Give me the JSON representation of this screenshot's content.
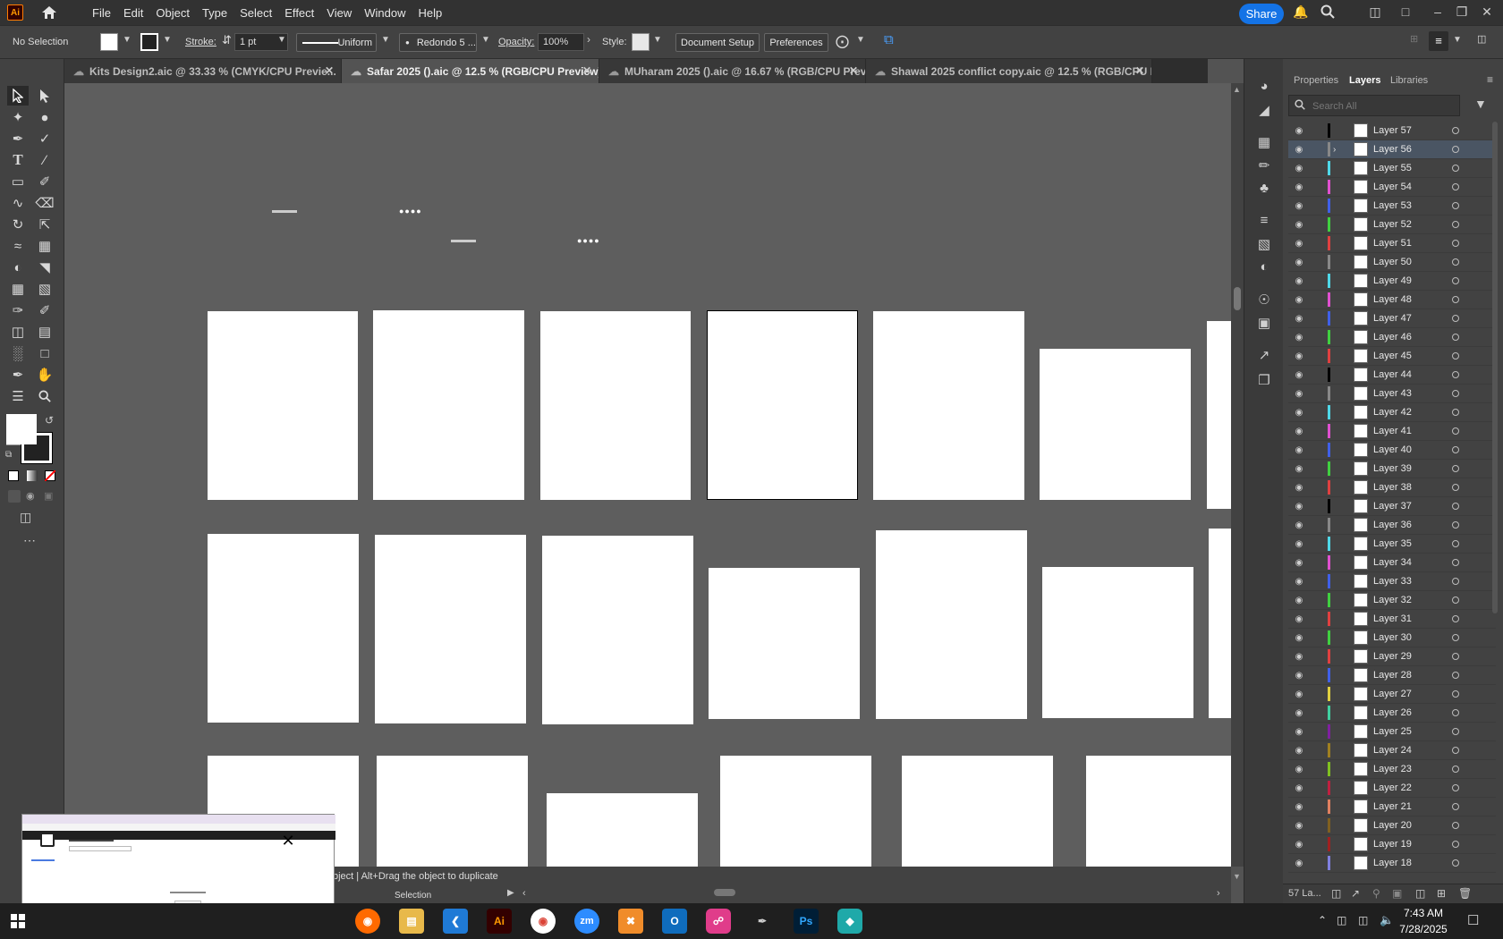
{
  "app": {
    "logo": "Ai",
    "name": "Adobe Illustrator"
  },
  "menu": [
    "File",
    "Edit",
    "Object",
    "Type",
    "Select",
    "Effect",
    "View",
    "Window",
    "Help"
  ],
  "topbar": {
    "share_label": "Share",
    "icons": [
      "notification-icon",
      "search-icon",
      "arrange-icon",
      "window-icon",
      "minimize-icon",
      "restore-icon",
      "close-icon"
    ]
  },
  "control": {
    "selection": "No Selection",
    "stroke_label": "Stroke:",
    "stroke_value": "1 pt",
    "uniform_label": "Uniform",
    "brush_label": "Redondo 5 ...",
    "opacity_label": "Opacity:",
    "opacity_value": "100%",
    "style_label": "Style:",
    "document_setup": "Document Setup",
    "preferences": "Preferences"
  },
  "tabs": [
    {
      "label": "Kits Design2.aic @ 33.33 % (CMYK/CPU Previe...",
      "active": false
    },
    {
      "label": "Safar 2025 ().aic @ 12.5 % (RGB/CPU Preview)",
      "active": true
    },
    {
      "label": "MUharam 2025 ().aic @ 16.67 % (RGB/CPU Previe...",
      "active": false
    },
    {
      "label": "Shawal 2025 conflict copy.aic @ 12.5 % (RGB/CPU Prev...",
      "active": false
    }
  ],
  "layers_panel": {
    "tabs": [
      "Properties",
      "Layers",
      "Libraries"
    ],
    "active_tab": "Layers",
    "search_placeholder": "Search All",
    "count_label": "57 La...",
    "layers": [
      {
        "name": "Layer 57",
        "color": "#000000"
      },
      {
        "name": "Layer 56",
        "color": "#888888",
        "selected": true
      },
      {
        "name": "Layer 55",
        "color": "#4fd8e8"
      },
      {
        "name": "Layer 54",
        "color": "#e050d0"
      },
      {
        "name": "Layer 53",
        "color": "#4060e8"
      },
      {
        "name": "Layer 52",
        "color": "#40d040"
      },
      {
        "name": "Layer 51",
        "color": "#e04040"
      },
      {
        "name": "Layer 50",
        "color": "#888888"
      },
      {
        "name": "Layer 49",
        "color": "#4fd8e8"
      },
      {
        "name": "Layer 48",
        "color": "#e050d0"
      },
      {
        "name": "Layer 47",
        "color": "#4060e8"
      },
      {
        "name": "Layer 46",
        "color": "#40d040"
      },
      {
        "name": "Layer 45",
        "color": "#e04040"
      },
      {
        "name": "Layer 44",
        "color": "#000000"
      },
      {
        "name": "Layer 43",
        "color": "#888888"
      },
      {
        "name": "Layer 42",
        "color": "#4fd8e8"
      },
      {
        "name": "Layer 41",
        "color": "#e050d0"
      },
      {
        "name": "Layer 40",
        "color": "#4060e8"
      },
      {
        "name": "Layer 39",
        "color": "#40d040"
      },
      {
        "name": "Layer 38",
        "color": "#e04040"
      },
      {
        "name": "Layer 37",
        "color": "#000000"
      },
      {
        "name": "Layer 36",
        "color": "#888888"
      },
      {
        "name": "Layer 35",
        "color": "#4fd8e8"
      },
      {
        "name": "Layer 34",
        "color": "#e050d0"
      },
      {
        "name": "Layer 33",
        "color": "#4060e8"
      },
      {
        "name": "Layer 32",
        "color": "#40d040"
      },
      {
        "name": "Layer 31",
        "color": "#e04040"
      },
      {
        "name": "Layer 30",
        "color": "#40d040"
      },
      {
        "name": "Layer 29",
        "color": "#e04040"
      },
      {
        "name": "Layer 28",
        "color": "#4060e8"
      },
      {
        "name": "Layer 27",
        "color": "#e0d040"
      },
      {
        "name": "Layer 26",
        "color": "#40d0a0"
      },
      {
        "name": "Layer 25",
        "color": "#8020a0"
      },
      {
        "name": "Layer 24",
        "color": "#a08020"
      },
      {
        "name": "Layer 23",
        "color": "#80c020"
      },
      {
        "name": "Layer 22",
        "color": "#c02040"
      },
      {
        "name": "Layer 21",
        "color": "#e08060"
      },
      {
        "name": "Layer 20",
        "color": "#806020"
      },
      {
        "name": "Layer 19",
        "color": "#a02020"
      },
      {
        "name": "Layer 18",
        "color": "#8080e0"
      }
    ]
  },
  "status": {
    "hint": "bject  |  Alt+Drag the object to duplicate",
    "tool": "Selection"
  },
  "taskbar": {
    "time": "7:43 AM",
    "date": "7/28/2025"
  }
}
